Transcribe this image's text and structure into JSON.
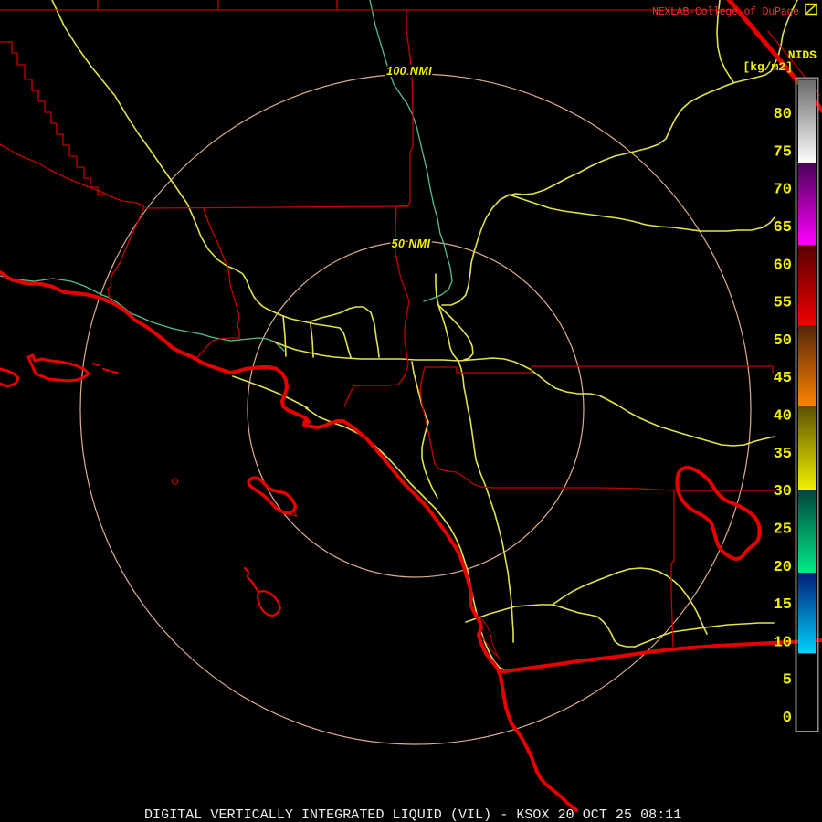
{
  "header": {
    "brand": "NEXLAB-College of DuPage",
    "nids_label": "NIDS",
    "units_label": "[kg/m2]"
  },
  "rings": {
    "outer_label": "100 NMI",
    "inner_label": "50 NMI"
  },
  "caption": "DIGITAL VERTICALLY INTEGRATED LIQUID (VIL) - KSOX 20 OCT 25 08:11",
  "colors": {
    "background": "#000000",
    "brand_red": "#ff2b2b",
    "thick_red": "#e60000",
    "thin_red": "#c40000",
    "road_yellow": "#e2e24e",
    "label_yellow": "#f2ef00",
    "river_teal": "#58bd8e",
    "ring_salmon": "#ddad8f",
    "caption_white": "#ededed",
    "bar_border_gray": "#8c8c8c"
  },
  "colorbar": {
    "units": "kg/m2",
    "ticks": [
      0,
      5,
      10,
      15,
      20,
      25,
      30,
      35,
      40,
      45,
      50,
      55,
      60,
      65,
      70,
      75,
      80
    ],
    "segments": [
      {
        "name": "gray",
        "top_value": 84.3,
        "bottom_value": 73.3,
        "top_color": "#6a6a6a",
        "bottom_color": "#ffffff"
      },
      {
        "name": "magenta",
        "top_value": 73.3,
        "bottom_value": 62.4,
        "top_color": "#4a0058",
        "bottom_color": "#ff00ff"
      },
      {
        "name": "red",
        "top_value": 62.4,
        "bottom_value": 51.7,
        "top_color": "#570000",
        "bottom_color": "#f20000"
      },
      {
        "name": "orange",
        "top_value": 51.7,
        "bottom_value": 41.0,
        "top_color": "#57250a",
        "bottom_color": "#ff8400"
      },
      {
        "name": "yellow",
        "top_value": 41.0,
        "bottom_value": 29.9,
        "top_color": "#5c5200",
        "bottom_color": "#f2f200"
      },
      {
        "name": "teal",
        "top_value": 29.9,
        "bottom_value": 19.0,
        "top_color": "#00463c",
        "bottom_color": "#00eb87"
      },
      {
        "name": "blue",
        "top_value": 19.0,
        "bottom_value": 8.3,
        "top_color": "#001e78",
        "bottom_color": "#00d2ff"
      },
      {
        "name": "black",
        "top_value": 8.3,
        "bottom_value": -1.9,
        "top_color": "#000000",
        "bottom_color": "#000000"
      }
    ]
  }
}
